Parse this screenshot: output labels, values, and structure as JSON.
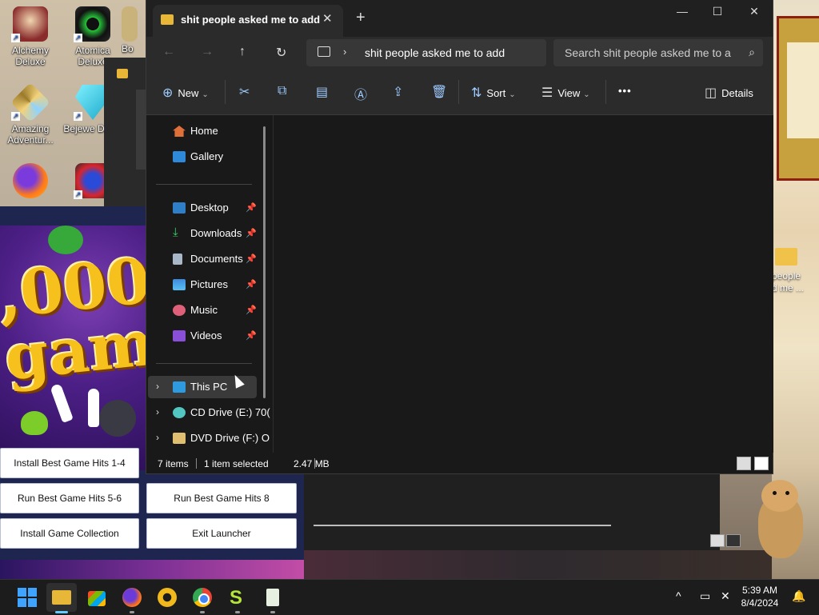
{
  "desktop": {
    "icons": [
      {
        "label": "Alchemy Deluxe"
      },
      {
        "label": "Atomica Deluxe"
      },
      {
        "label": "Bo"
      },
      {
        "label": "Amazing Adventur..."
      },
      {
        "label": "Bejewe Delux"
      }
    ],
    "side_folder_label": "people\nd me ..."
  },
  "launcher": {
    "buttons": [
      "Install Best Game Hits 1-4",
      "Run Best Game Hits 5-6",
      "Run Best Game Hits 8",
      "Install Game Collection",
      "Exit Launcher"
    ],
    "art_title": ",000\ngam"
  },
  "explorer": {
    "tab_title": "shit people asked me to add",
    "new_tab": "+",
    "window_controls": {
      "minimize": "—",
      "maximize": "☐",
      "close": "✕"
    },
    "address": "shit people asked me to add",
    "search_placeholder": "Search shit people asked me to a",
    "commands": {
      "new": "New",
      "sort": "Sort",
      "view": "View",
      "more": "•••",
      "details": "Details"
    },
    "nav": {
      "home": "Home",
      "gallery": "Gallery",
      "desktop": "Desktop",
      "downloads": "Downloads",
      "documents": "Documents",
      "pictures": "Pictures",
      "music": "Music",
      "videos": "Videos",
      "this_pc": "This PC",
      "cd_drive": "CD Drive (E:) 70(",
      "dvd_drive": "DVD Drive (F:) O"
    },
    "status": {
      "items": "7 items",
      "selected": "1 item selected",
      "size": "2.47 MB"
    }
  },
  "taskbar": {
    "time": "5:39 AM",
    "date": "8/4/2024"
  },
  "colors": {
    "explorer_bg": "#191919",
    "toolbar_bg": "#2b2b2b",
    "accent": "#60cdff",
    "folder": "#e8b737"
  }
}
